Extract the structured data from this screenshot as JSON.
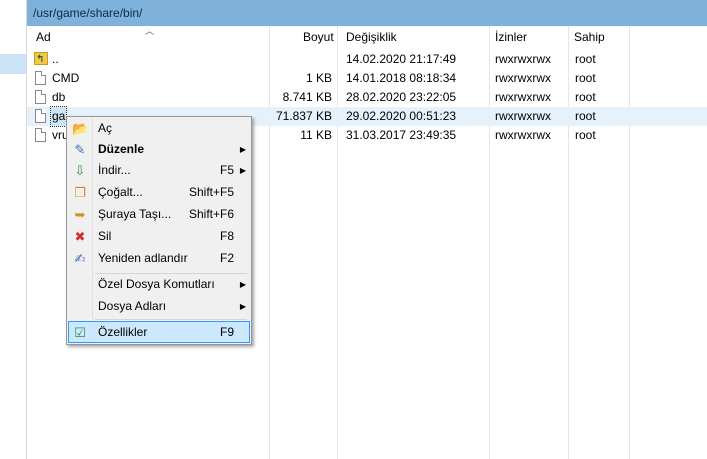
{
  "path": "/usr/game/share/bin/",
  "columns": {
    "name": "Ad",
    "size": "Boyut",
    "modified": "Değişiklik",
    "permissions": "İzinler",
    "owner": "Sahip"
  },
  "files": [
    {
      "name": "..",
      "size": "",
      "modified": "14.02.2020 21:17:49",
      "permissions": "rwxrwxrwx",
      "owner": "root"
    },
    {
      "name": "CMD",
      "size": "1 KB",
      "modified": "14.01.2018 08:18:34",
      "permissions": "rwxrwxrwx",
      "owner": "root"
    },
    {
      "name": "db",
      "size": "8.741 KB",
      "modified": "28.02.2020 23:22:05",
      "permissions": "rwxrwxrwx",
      "owner": "root"
    },
    {
      "name": "ga",
      "size": "71.837 KB",
      "modified": "29.02.2020 00:51:23",
      "permissions": "rwxrwxrwx",
      "owner": "root"
    },
    {
      "name": "vru",
      "size": "11 KB",
      "modified": "31.03.2017 23:49:35",
      "permissions": "rwxrwxrwx",
      "owner": "root"
    }
  ],
  "context_menu": {
    "open": "Aç",
    "edit": "Düzenle",
    "download": "İndir...",
    "download_shortcut": "F5",
    "duplicate": "Çoğalt...",
    "duplicate_shortcut": "Shift+F5",
    "move": "Şuraya Taşı...",
    "move_shortcut": "Shift+F6",
    "delete": "Sil",
    "delete_shortcut": "F8",
    "rename": "Yeniden adlandır",
    "rename_shortcut": "F2",
    "custom_commands": "Özel Dosya Komutları",
    "file_names": "Dosya Adları",
    "properties": "Özellikler",
    "properties_shortcut": "F9"
  }
}
